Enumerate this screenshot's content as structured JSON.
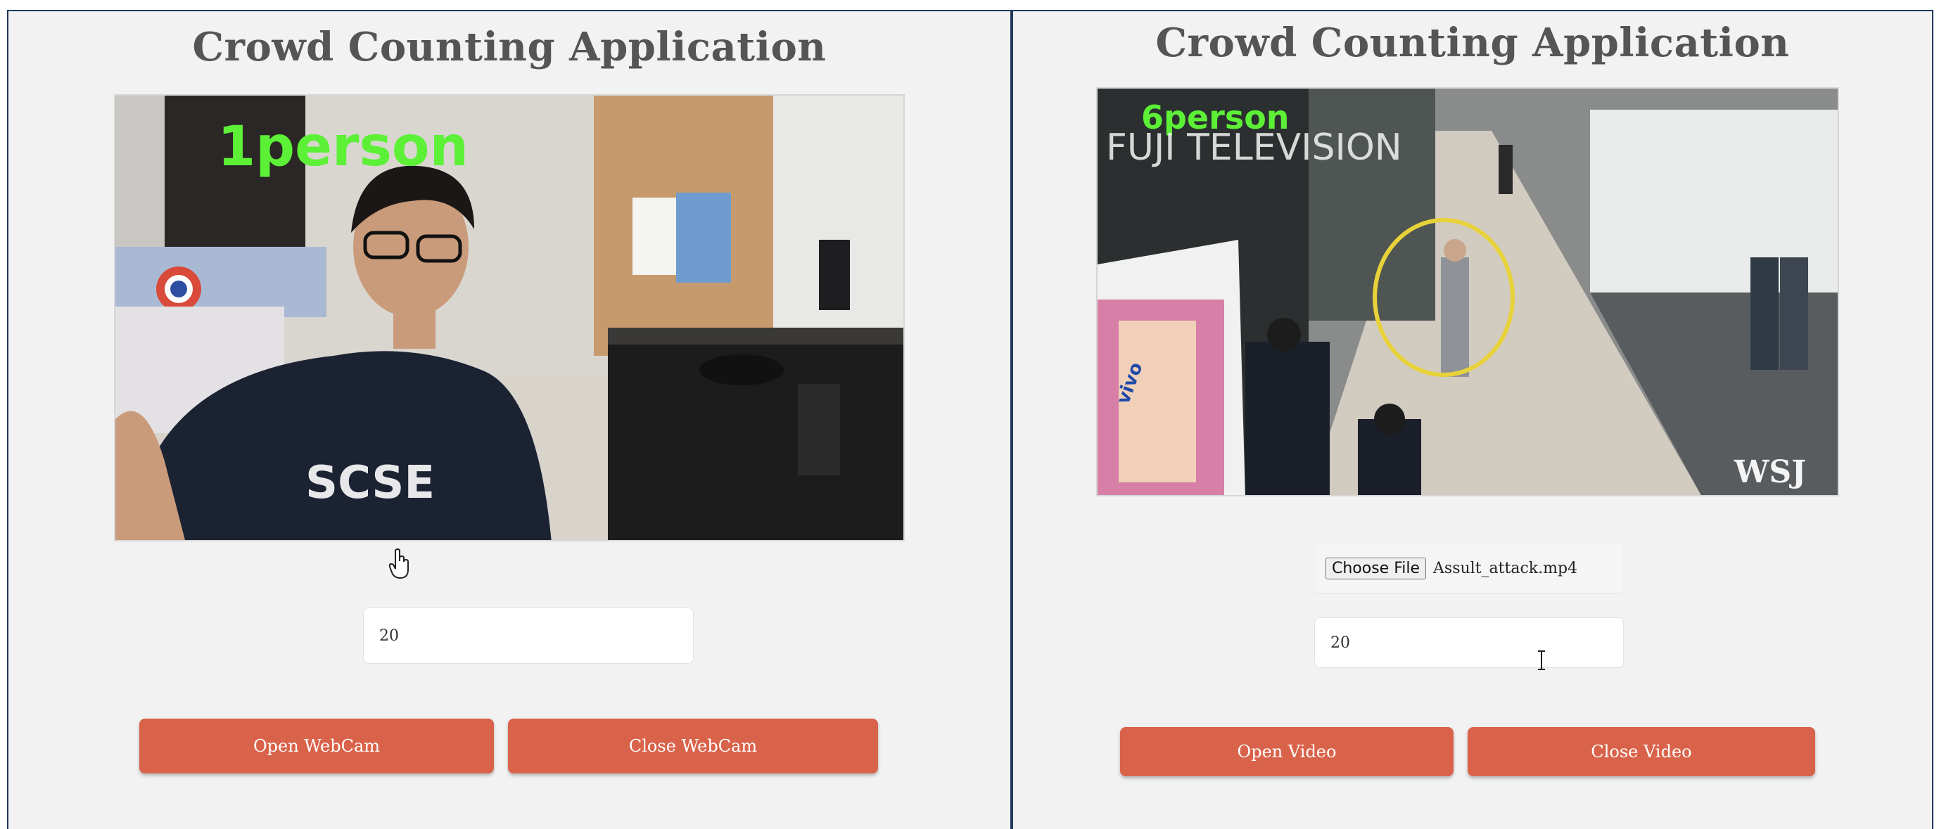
{
  "left": {
    "title": "Crowd Counting Application",
    "video_overlay": "1person",
    "shirt_logo": "SCSE",
    "count_value": "20",
    "open_label": "Open WebCam",
    "close_label": "Close WebCam"
  },
  "right": {
    "title": "Crowd Counting Application",
    "video_overlay": "6person",
    "broadcaster_text": "FUJI TELEVISION",
    "billboard_brand": "vivo",
    "source_watermark": "WSJ",
    "file_button_label": "Choose File",
    "file_name": "Assult_attack.mp4",
    "count_value": "20",
    "open_label": "Open Video",
    "close_label": "Close Video"
  },
  "colors": {
    "button": "#d9634a",
    "panel_bg": "#f2f2f2",
    "panel_border": "#1f3a5c",
    "overlay_text": "#5cf036",
    "highlight_circle": "#e8d23a"
  }
}
